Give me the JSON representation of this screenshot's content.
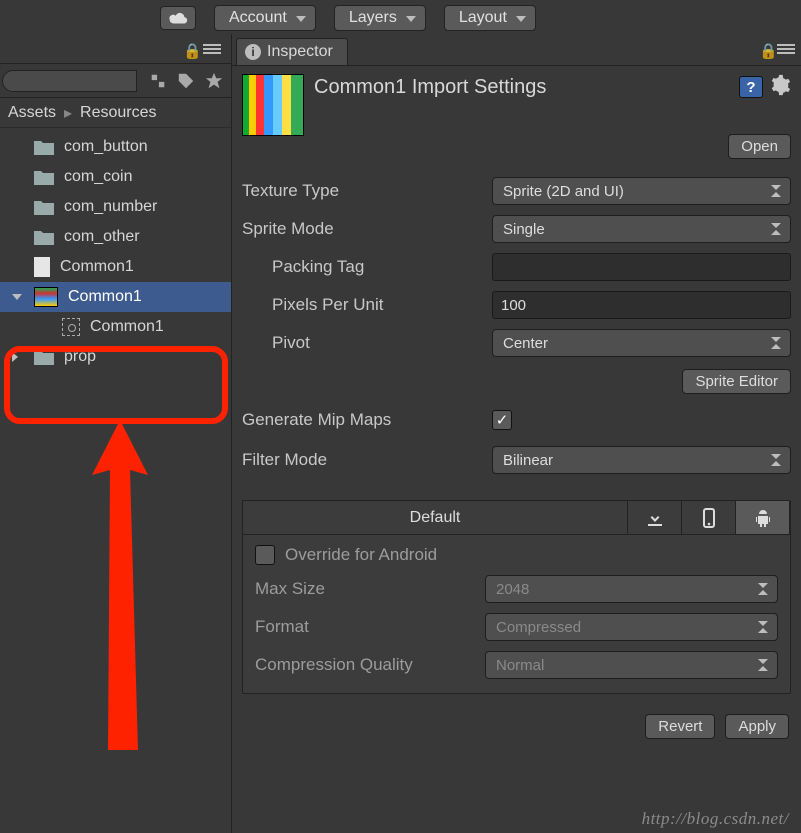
{
  "toolbar": {
    "account": "Account",
    "layers": "Layers",
    "layout": "Layout"
  },
  "projectPanel": {
    "breadcrumb": {
      "root": "Assets",
      "folder": "Resources"
    },
    "items": [
      {
        "name": "com_button",
        "type": "folder"
      },
      {
        "name": "com_coin",
        "type": "folder"
      },
      {
        "name": "com_number",
        "type": "folder"
      },
      {
        "name": "com_other",
        "type": "folder"
      },
      {
        "name": "Common1",
        "type": "file"
      },
      {
        "name": "Common1",
        "type": "sprite",
        "selected": true
      },
      {
        "name": "Common1",
        "type": "sprite-child"
      },
      {
        "name": "prop",
        "type": "folder"
      }
    ]
  },
  "inspector": {
    "tabLabel": "Inspector",
    "title": "Common1 Import Settings",
    "openLabel": "Open",
    "textureType": {
      "label": "Texture Type",
      "value": "Sprite (2D and UI)"
    },
    "spriteMode": {
      "label": "Sprite Mode",
      "value": "Single"
    },
    "packingTag": {
      "label": "Packing Tag",
      "value": ""
    },
    "pixelsPerUnit": {
      "label": "Pixels Per Unit",
      "value": "100"
    },
    "pivot": {
      "label": "Pivot",
      "value": "Center"
    },
    "spriteEditorLabel": "Sprite Editor",
    "generateMipMaps": {
      "label": "Generate Mip Maps",
      "on": true
    },
    "filterMode": {
      "label": "Filter Mode",
      "value": "Bilinear"
    },
    "platform": {
      "defaultTab": "Default",
      "override": {
        "label": "Override for Android",
        "on": false
      },
      "maxSize": {
        "label": "Max Size",
        "value": "2048"
      },
      "format": {
        "label": "Format",
        "value": "Compressed"
      },
      "quality": {
        "label": "Compression Quality",
        "value": "Normal"
      }
    },
    "revertLabel": "Revert",
    "applyLabel": "Apply"
  },
  "watermark": "http://blog.csdn.net/"
}
